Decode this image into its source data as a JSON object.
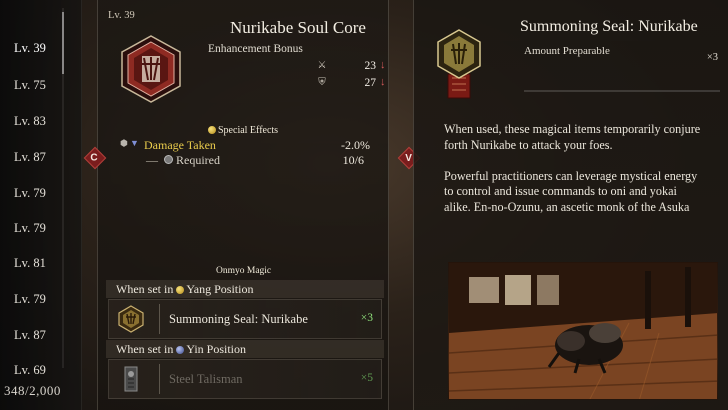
{
  "level_list": {
    "items": [
      "Lv. 39",
      "Lv. 75",
      "Lv. 83",
      "Lv. 87",
      "Lv. 79",
      "Lv. 79",
      "Lv. 81",
      "Lv. 79",
      "Lv. 87",
      "Lv. 69"
    ],
    "selected_index": 0,
    "inventory_count": "348/2,000"
  },
  "soul_core": {
    "level": "Lv. 39",
    "title": "Nurikabe Soul Core",
    "bonus_label": "Enhancement Bonus",
    "stats": [
      {
        "icon": "sword-icon",
        "value": "23",
        "trend": "↓"
      },
      {
        "icon": "armor-icon",
        "value": "27",
        "trend": "↓"
      }
    ],
    "special_effects_heading": "Special Effects",
    "effect": {
      "name": "Damage Taken",
      "value": "-2.0%"
    },
    "required": {
      "label": "Required",
      "value": "10/6"
    },
    "onmyo_heading": "Onmyo Magic",
    "yang": {
      "prefix": "When set in",
      "position": "Yang Position",
      "item_name": "Summoning Seal: Nurikabe",
      "qty": "×3"
    },
    "yin": {
      "prefix": "When set in",
      "position": "Yin Position",
      "item_name": "Steel Talisman",
      "qty": "×5"
    },
    "key_hint": "C"
  },
  "seal": {
    "title": "Summoning Seal: Nurikabe",
    "amount_label": "Amount Preparable",
    "amount_value": "×3",
    "key_hint": "V",
    "description": [
      "When used, these magical items temporarily conjure forth Nurikabe to attack your foes.",
      "Powerful practitioners can leverage mystical energy to control and issue commands to oni and yokai alike. En-no-Ozunu, an ascetic monk of the Asuka"
    ]
  },
  "colors": {
    "accent_gold": "#e9cc4c",
    "stat_down_red": "#d45a5a",
    "qty_green": "#8ee07a",
    "key_hint_red": "#7a1d1d"
  }
}
